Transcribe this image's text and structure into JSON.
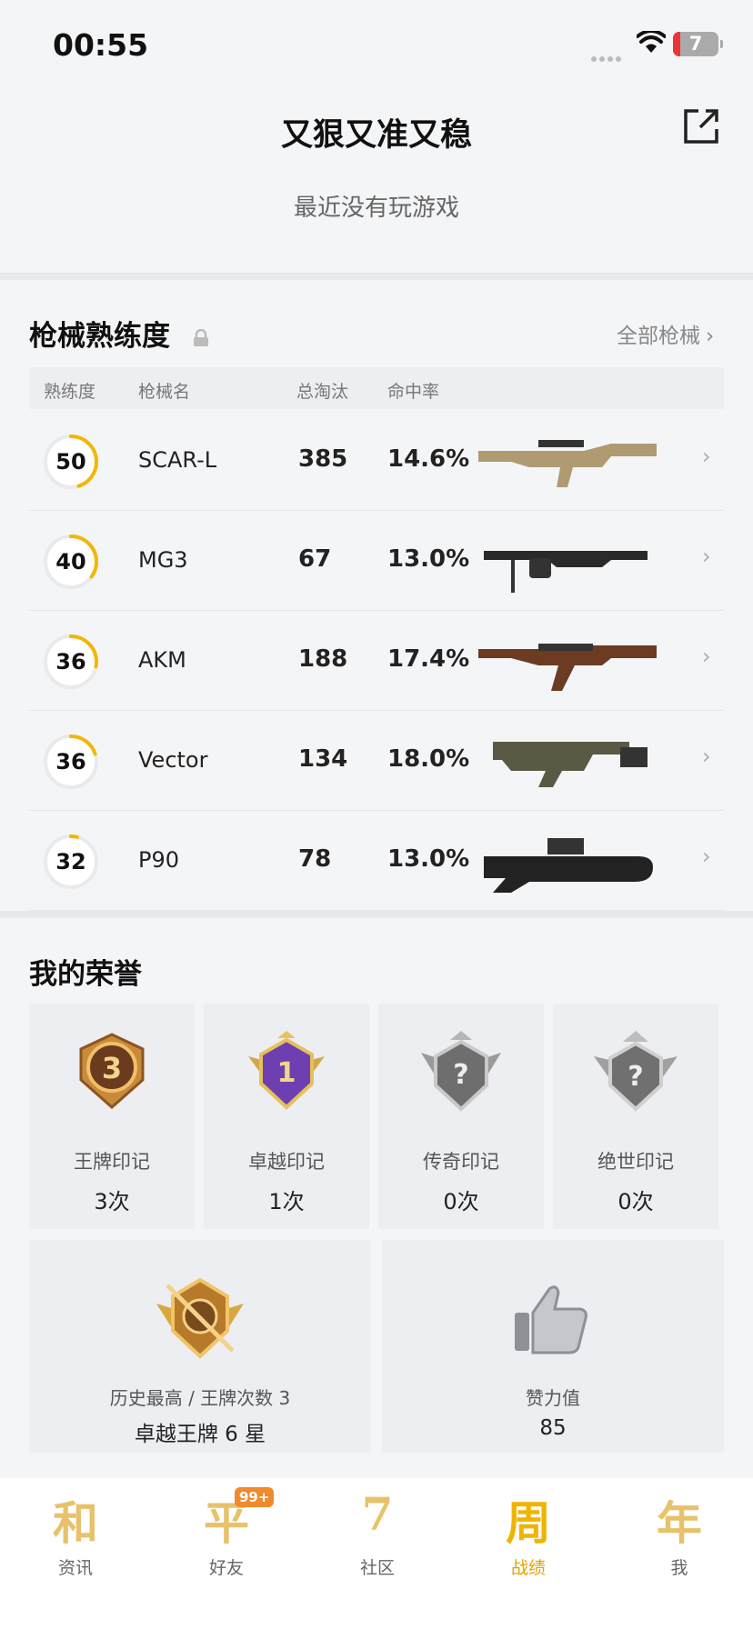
{
  "status_bar": {
    "time": "00:55",
    "battery": "7"
  },
  "header": {
    "title": "又狠又准又稳",
    "subtitle": "最近没有玩游戏"
  },
  "weapons": {
    "title": "枪械熟练度",
    "all_link": "全部枪械",
    "columns": {
      "proficiency": "熟练度",
      "name": "枪械名",
      "kills": "总淘汰",
      "accuracy": "命中率"
    },
    "rows": [
      {
        "level": "50",
        "name": "SCAR-L",
        "kills": "385",
        "accuracy": "14.6%",
        "progress": 0.45
      },
      {
        "level": "40",
        "name": "MG3",
        "kills": "67",
        "accuracy": "13.0%",
        "progress": 0.35
      },
      {
        "level": "36",
        "name": "AKM",
        "kills": "188",
        "accuracy": "17.4%",
        "progress": 0.28
      },
      {
        "level": "36",
        "name": "Vector",
        "kills": "134",
        "accuracy": "18.0%",
        "progress": 0.2
      },
      {
        "level": "32",
        "name": "P90",
        "kills": "78",
        "accuracy": "13.0%",
        "progress": 0.04
      }
    ]
  },
  "honors": {
    "title": "我的荣誉",
    "medals": [
      {
        "label": "王牌印记",
        "count": "3次",
        "badge": "3"
      },
      {
        "label": "卓越印记",
        "count": "1次",
        "badge": "1"
      },
      {
        "label": "传奇印记",
        "count": "0次",
        "badge": "?"
      },
      {
        "label": "绝世印记",
        "count": "0次",
        "badge": "?"
      }
    ],
    "highest": {
      "label": "历史最高 / 王牌次数 3",
      "value": "卓越王牌 6 星"
    },
    "likes": {
      "label": "赞力值",
      "value": "85"
    }
  },
  "tabbar": {
    "items": [
      {
        "glyph": "和",
        "label": "资讯"
      },
      {
        "glyph": "平",
        "label": "好友",
        "badge": "99+"
      },
      {
        "glyph": "7",
        "label": "社区"
      },
      {
        "glyph": "周",
        "label": "战绩"
      },
      {
        "glyph": "年",
        "label": "我"
      }
    ]
  },
  "colors": {
    "accent": "#f2b705",
    "bg": "#f4f5f7",
    "card": "#eceef1"
  }
}
